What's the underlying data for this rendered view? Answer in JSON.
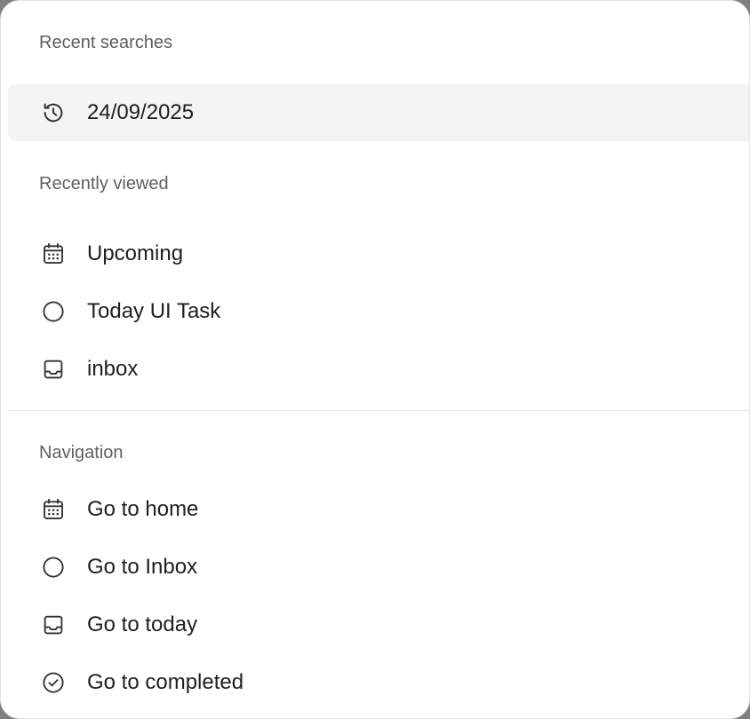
{
  "recent_searches": {
    "title": "Recent searches",
    "items": [
      {
        "label": "24/09/2025",
        "icon": "history-icon"
      }
    ]
  },
  "recently_viewed": {
    "title": "Recently viewed",
    "items": [
      {
        "label": "Upcoming",
        "icon": "calendar-icon"
      },
      {
        "label": "Today UI Task",
        "icon": "circle-icon"
      },
      {
        "label": "inbox",
        "icon": "inbox-icon"
      }
    ]
  },
  "navigation": {
    "title": "Navigation",
    "items": [
      {
        "label": "Go to home",
        "icon": "calendar-icon"
      },
      {
        "label": "Go to Inbox",
        "icon": "circle-icon"
      },
      {
        "label": "Go to today",
        "icon": "inbox-icon"
      },
      {
        "label": "Go to completed",
        "icon": "check-circle-icon"
      }
    ]
  },
  "colors": {
    "highlight": "#f4f4f4",
    "section_title": "#5f5f5f",
    "label": "#202020",
    "icon": "#333333"
  }
}
